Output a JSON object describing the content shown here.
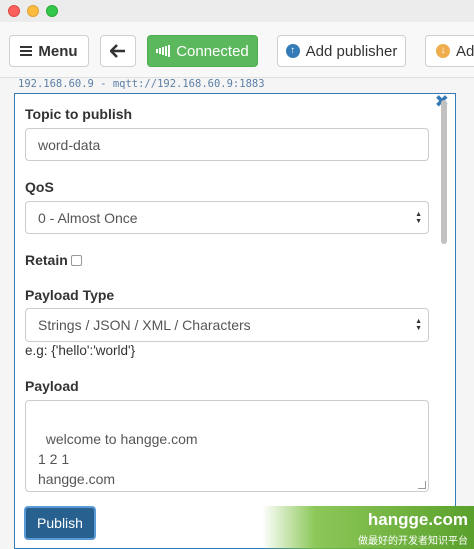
{
  "toolbar": {
    "menu_label": "Menu",
    "connected_label": "Connected",
    "add_publisher_label": "Add publisher",
    "add_subscriber_label": "Add subscriber"
  },
  "connection": {
    "info": "192.168.60.9 - mqtt://192.168.60.9:1883"
  },
  "publisher": {
    "topic_label": "Topic to publish",
    "topic_value": "word-data",
    "qos_label": "QoS",
    "qos_value": "0 - Almost Once",
    "retain_label": "Retain",
    "payload_type_label": "Payload Type",
    "payload_type_value": "Strings / JSON / XML / Characters",
    "payload_example": "e.g: {'hello':'world'}",
    "payload_label": "Payload",
    "payload_value": "welcome to hangge.com\n1 2 1\nhangge.com",
    "publish_label": "Publish"
  },
  "watermark": {
    "title": "hangge.com",
    "subtitle": "做最好的开发者知识平台"
  },
  "colors": {
    "connected": "#5cb85c",
    "primary": "#337ab7",
    "publish": "#286090"
  }
}
